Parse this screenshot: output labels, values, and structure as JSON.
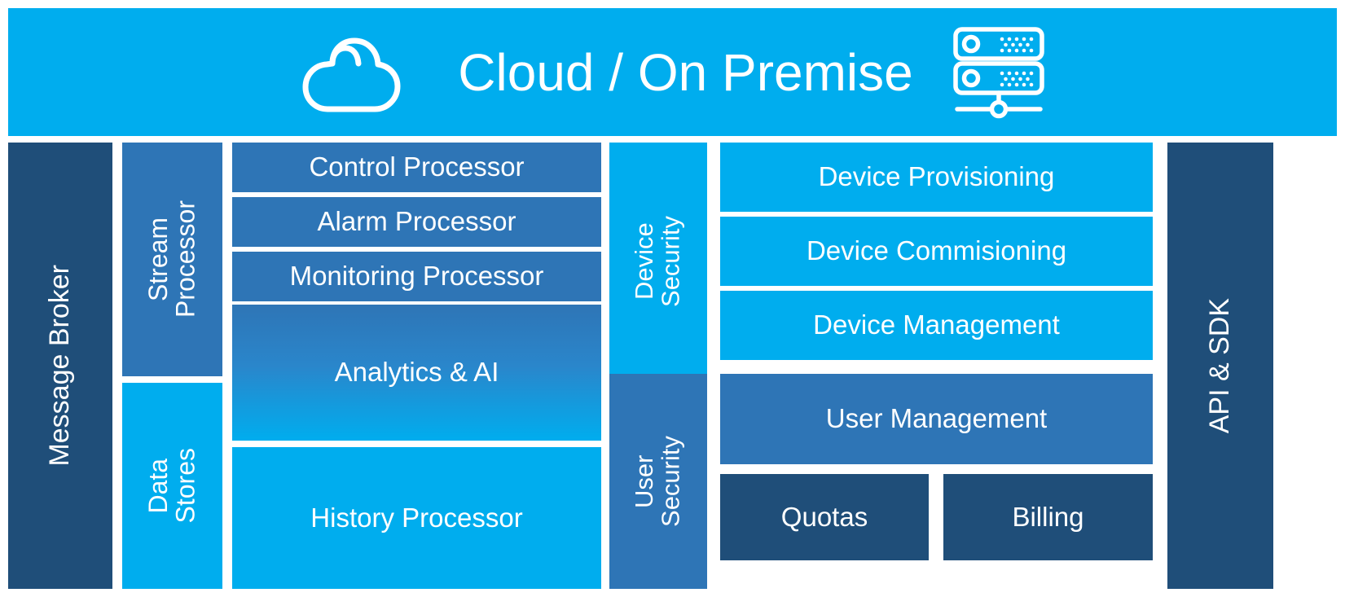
{
  "header": {
    "title": "Cloud / On Premise",
    "cloud_icon": "cloud-icon",
    "server_icon": "server-rack-icon",
    "background_color": "#00ADEE"
  },
  "colors": {
    "cyan": "#00ADEE",
    "blue": "#2E75B6",
    "navy": "#1F4E79",
    "white": "#FFFFFF"
  },
  "columns": {
    "message_broker": {
      "label": "Message Broker",
      "color": "#1F4E79"
    },
    "api_sdk": {
      "label": "API & SDK",
      "color": "#1F4E79"
    }
  },
  "stream_column": {
    "stream_processor": {
      "label": "Stream\nProcessor",
      "color": "#2E75B6"
    },
    "data_stores": {
      "label": "Data\nStores",
      "color": "#00ADEE"
    }
  },
  "processors": [
    {
      "label": "Control Processor",
      "color": "#2E75B6"
    },
    {
      "label": "Alarm Processor",
      "color": "#2E75B6"
    },
    {
      "label": "Monitoring Processor",
      "color": "#2E75B6"
    },
    {
      "label": "Analytics & AI",
      "color": "gradient-blue-to-cyan"
    },
    {
      "label": "History Processor",
      "color": "#00ADEE"
    }
  ],
  "security_column": {
    "device_security": {
      "label": "Device\nSecurity",
      "color": "#00ADEE"
    },
    "user_security": {
      "label": "User\nSecurity",
      "color": "#2E75B6"
    }
  },
  "device_services": [
    {
      "label": "Device Provisioning",
      "color": "#00ADEE"
    },
    {
      "label": "Device Commisioning",
      "color": "#00ADEE"
    },
    {
      "label": "Device Management",
      "color": "#00ADEE"
    }
  ],
  "user_services": [
    {
      "label": "User Management",
      "color": "#2E75B6"
    }
  ],
  "billing_services": [
    {
      "label": "Quotas",
      "color": "#1F4E79"
    },
    {
      "label": "Billing",
      "color": "#1F4E79"
    }
  ]
}
